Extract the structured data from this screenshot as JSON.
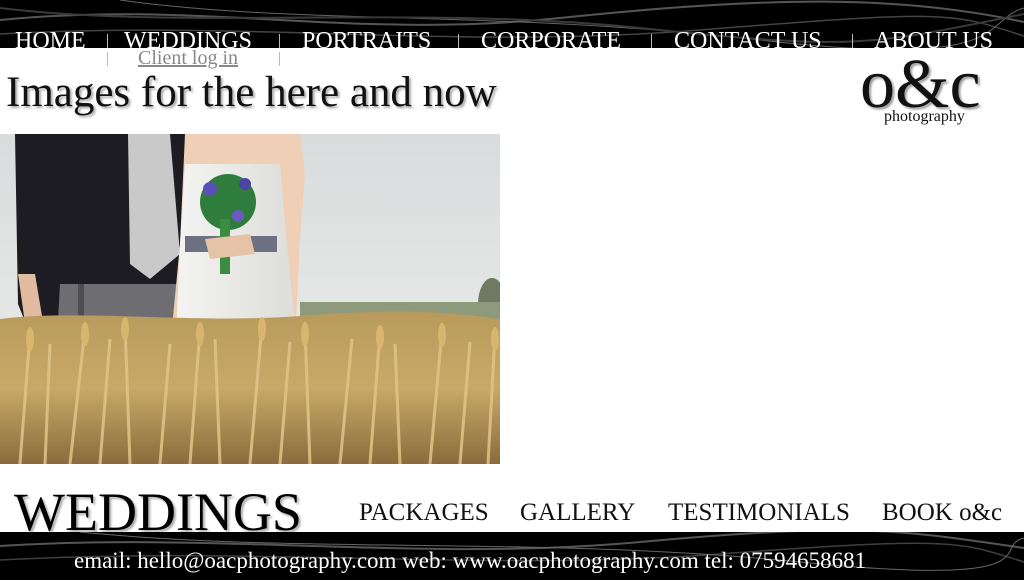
{
  "nav": {
    "items": [
      "HOME",
      "WEDDINGS",
      "PORTRAITS",
      "CORPORATE",
      "CONTACT US",
      "ABOUT US"
    ],
    "client_login": "Client log in"
  },
  "header": {
    "tagline": "Images for the here and now",
    "logo_mark": "o&c",
    "logo_sub": "photography"
  },
  "hero": {
    "image": "wedding-couple-in-wheat-field"
  },
  "section": {
    "title": "WEDDINGS",
    "links": [
      "PACKAGES",
      "GALLERY",
      "TESTIMONIALS",
      "BOOK o&c"
    ]
  },
  "footer": {
    "contact": "email: hello@oacphotography.com  web: www.oacphotography.com  tel:  07594658681"
  },
  "colors": {
    "bar": "#000000",
    "text": "#111111",
    "link_muted": "#888888",
    "wheat": "#c8a664"
  }
}
